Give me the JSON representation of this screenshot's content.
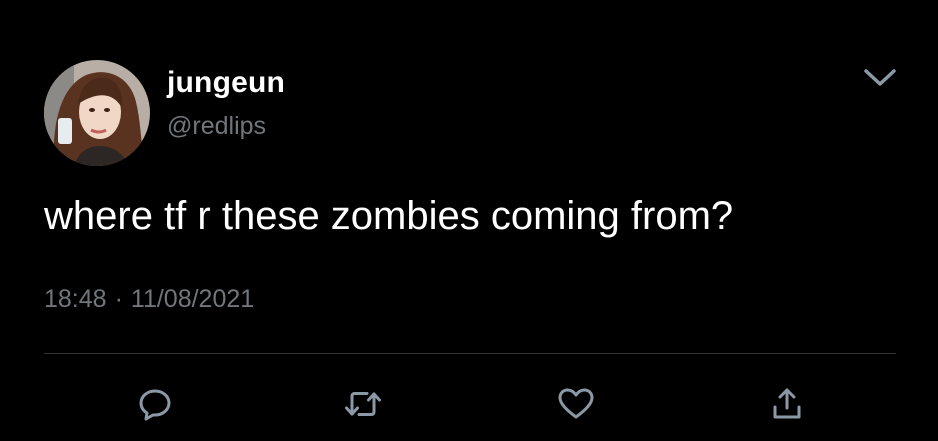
{
  "tweet": {
    "author": {
      "display_name": "jungeun",
      "handle": "@redlips"
    },
    "text": "where tf r these zombies coming from?",
    "time": "18:48",
    "separator": "·",
    "date": "11/08/2021"
  },
  "actions": [
    {
      "name": "reply",
      "icon": "reply-icon"
    },
    {
      "name": "retweet",
      "icon": "retweet-icon"
    },
    {
      "name": "like",
      "icon": "heart-icon"
    },
    {
      "name": "share",
      "icon": "share-icon"
    }
  ],
  "colors": {
    "background": "#000000",
    "text_primary": "#ffffff",
    "text_secondary": "#71767b",
    "divider": "#2f3336",
    "icon": "#8b98a5"
  }
}
